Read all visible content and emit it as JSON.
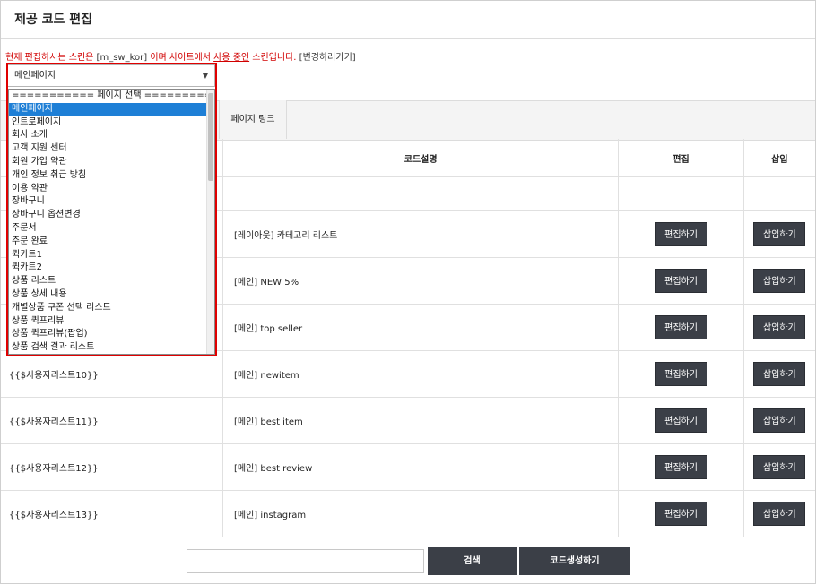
{
  "title": "제공 코드 편집",
  "notice": {
    "part1": "현재 편집하시는 스킨은",
    "skin_code": "[m_sw_kor]",
    "part2": "이며 사이트에서",
    "in_use": "사용 중인",
    "part3": "스킨입니다.",
    "change_link": "[변경하러가기]"
  },
  "page_select": {
    "value": "메인페이지",
    "options": [
      "=========== 페이지 선택 ===========",
      "메인페이지",
      "인트로페이지",
      "회사 소개",
      "고객 지원 센터",
      "회원 가입 약관",
      "개인 정보 취급 방침",
      "이용 약관",
      "장바구니",
      "장바구니 옵션변경",
      "주문서",
      "주문 완료",
      "퀵카트1",
      "퀵카트2",
      "상품 리스트",
      "상품 상세 내용",
      "개별상품 쿠폰 선택 리스트",
      "상품 퀵프리뷰",
      "상품 퀵프리뷰(팝업)",
      "상품 검색 결과 리스트"
    ],
    "selected_index": 1
  },
  "tab": {
    "page_link": "페이지 링크"
  },
  "table": {
    "headers": {
      "code_desc": "코드설명",
      "edit": "편집",
      "insert": "삽입"
    },
    "edit_label": "편집하기",
    "insert_label": "삽입하기",
    "rows": [
      {
        "code": "",
        "desc": "[레이아웃] 카테고리 리스트"
      },
      {
        "code": "",
        "desc": "[메인] NEW 5%"
      },
      {
        "code": "",
        "desc": "[메인] top seller"
      },
      {
        "code": "{{$사용자리스트10}}",
        "desc": "[메인] newitem"
      },
      {
        "code": "{{$사용자리스트11}}",
        "desc": "[메인] best item"
      },
      {
        "code": "{{$사용자리스트12}}",
        "desc": "[메인] best review"
      },
      {
        "code": "{{$사용자리스트13}}",
        "desc": "[메인] instagram"
      }
    ]
  },
  "footer": {
    "search_value": "",
    "search_label": "검색",
    "generate_label": "코드생성하기"
  }
}
